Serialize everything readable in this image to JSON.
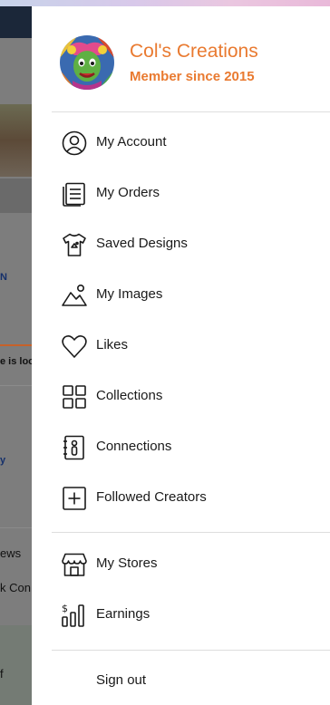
{
  "background": {
    "partial_text": [
      "N",
      "y",
      "ews",
      "k Con",
      "e is lool",
      "f"
    ]
  },
  "profile": {
    "name": "Col's Creations",
    "member_since": "Member since 2015"
  },
  "menu": {
    "primary": [
      {
        "label": "My Account",
        "icon": "user-circle-icon"
      },
      {
        "label": "My Orders",
        "icon": "orders-list-icon"
      },
      {
        "label": "Saved Designs",
        "icon": "tshirt-icon"
      },
      {
        "label": "My Images",
        "icon": "mountain-image-icon"
      },
      {
        "label": "Likes",
        "icon": "heart-icon"
      },
      {
        "label": "Collections",
        "icon": "grid-icon"
      },
      {
        "label": "Connections",
        "icon": "contacts-book-icon"
      },
      {
        "label": "Followed Creators",
        "icon": "plus-square-icon"
      }
    ],
    "store": [
      {
        "label": "My Stores",
        "icon": "storefront-icon"
      },
      {
        "label": "Earnings",
        "icon": "earnings-chart-icon"
      }
    ],
    "sign_out": "Sign out"
  },
  "colors": {
    "accent": "#e97a30",
    "text": "#1a1a1a",
    "overlay": "#7d7d7d"
  }
}
